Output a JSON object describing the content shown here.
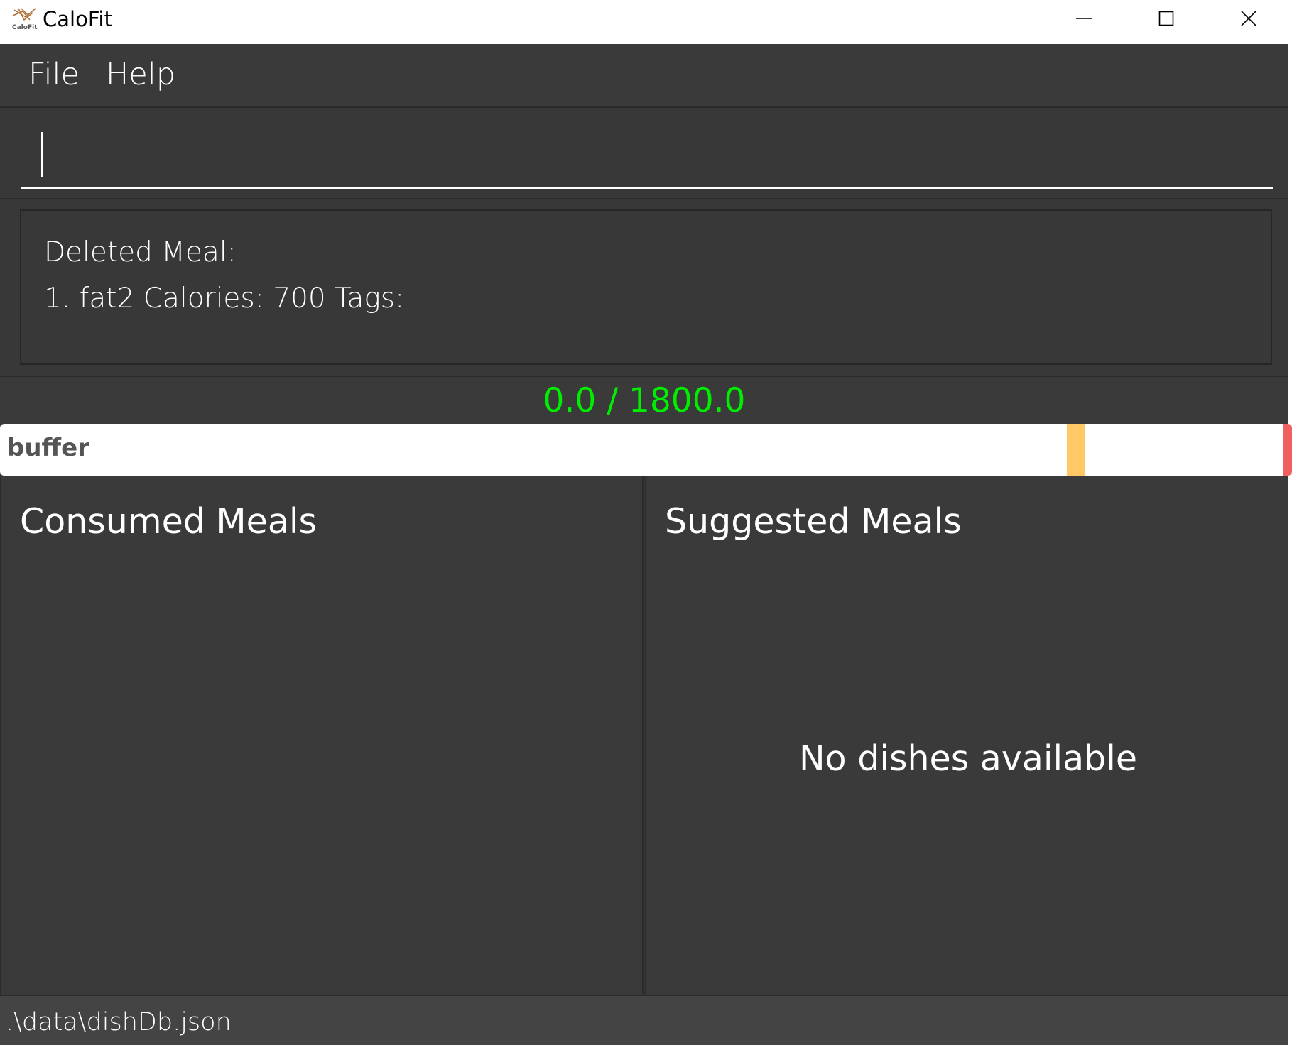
{
  "window": {
    "title": "CaloFit",
    "logo_icon": "calofit-logo-icon",
    "controls": [
      "minimize-icon",
      "maximize-icon",
      "close-icon"
    ]
  },
  "menu": {
    "file": "File",
    "help": "Help"
  },
  "command": {
    "value": "",
    "placeholder": ""
  },
  "result": {
    "line1": "Deleted Meal:",
    "line2": "1. fat2 Calories: 700 Tags:"
  },
  "calorie": {
    "display": "0.0 / 1800.0",
    "color": "#00ee00"
  },
  "progress": {
    "label": "buffer",
    "buffer_color": "#ffc766",
    "limit_color": "#f06060"
  },
  "consumed": {
    "title": "Consumed Meals"
  },
  "suggested": {
    "title": "Suggested Meals",
    "empty_message": "No dishes available"
  },
  "status": {
    "path": ".\\data\\dishDb.json"
  }
}
